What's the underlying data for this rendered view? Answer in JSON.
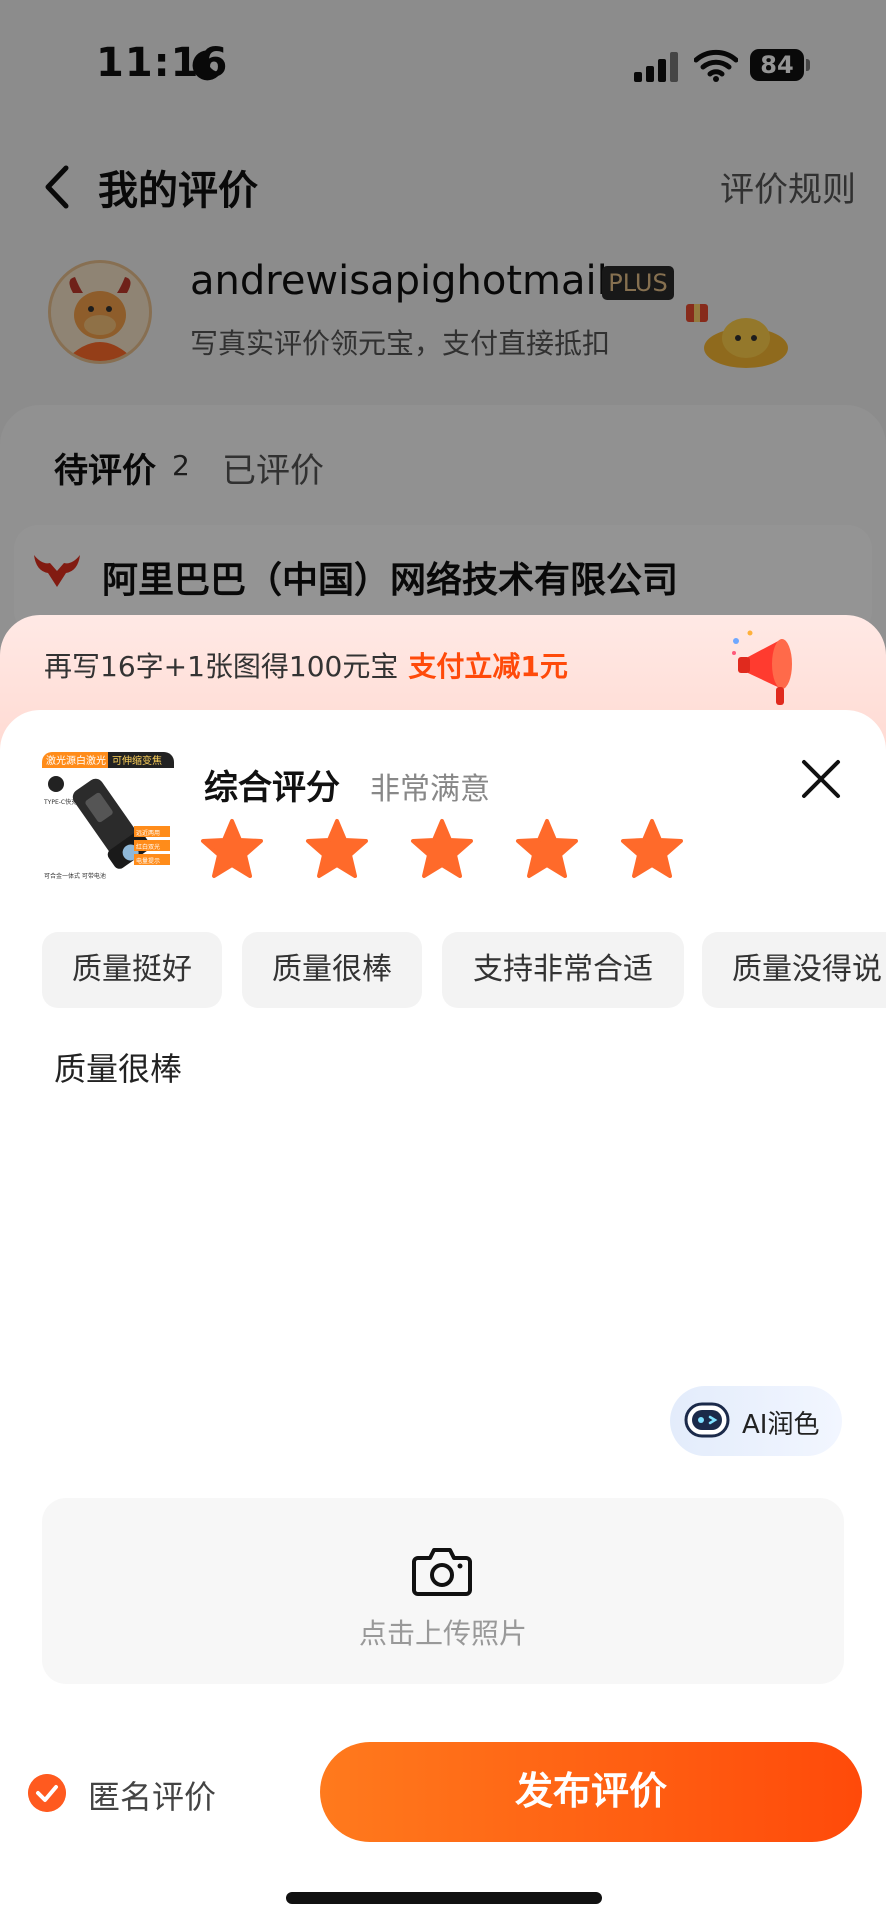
{
  "status_bar": {
    "time": "11:16",
    "battery": "84"
  },
  "nav": {
    "title": "我的评价",
    "rules_link": "评价规则"
  },
  "profile": {
    "username": "andrewisapighotmail",
    "badge": "PLUS",
    "subtitle": "写真实评价领元宝，支付直接抵扣"
  },
  "tabs": {
    "pending": "待评价",
    "pending_count": "2",
    "done": "已评价"
  },
  "shop": {
    "name": "阿里巴巴（中国）网络技术有限公司"
  },
  "promo": {
    "text": "再写16字+1张图得100元宝",
    "highlight": "支付立减1元"
  },
  "review": {
    "rating_title": "综合评分",
    "rating_desc": "非常满意",
    "stars": 5,
    "star_max": 5,
    "tags": [
      "质量挺好",
      "质量很棒",
      "支持非常合适",
      "质量没得说"
    ],
    "comment": "质量很棒",
    "ai_polish_label": "AI润色",
    "upload_label": "点击上传照片",
    "anonymous_label": "匿名评价",
    "anonymous_checked": true,
    "publish_label": "发布评价"
  },
  "product_image": {
    "banner_left": "激光源白激光",
    "banner_right": "可伸缩变焦",
    "port_label": "TYPE-C快充",
    "features": [
      "远近两用",
      "红白双光",
      "电量提示"
    ],
    "caption": "可合金一体式 可带电池"
  },
  "colors": {
    "accent": "#ff4a0a",
    "star": "#ff6a2a",
    "check": "#ff5a1f"
  }
}
